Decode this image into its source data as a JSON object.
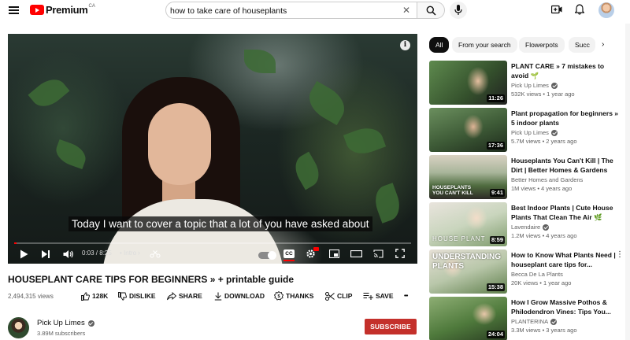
{
  "header": {
    "logo_text": "Premium",
    "region": "CA",
    "search_value": "how to take care of houseplants",
    "clear_symbol": "✕"
  },
  "player": {
    "caption": "Today I want to cover a topic that a lot of you have asked about",
    "time": "0:03 / 8:25",
    "chapter": "• Intro",
    "progress_fraction": 0.006,
    "cc_label": "CC",
    "info_symbol": "i"
  },
  "video": {
    "title": "HOUSEPLANT CARE TIPS FOR BEGINNERS » + printable guide",
    "views": "2,494,315 views",
    "actions": {
      "like": "128K",
      "dislike": "DISLIKE",
      "share": "SHARE",
      "download": "DOWNLOAD",
      "thanks": "THANKS",
      "clip": "CLIP",
      "save": "SAVE",
      "more": "•••"
    },
    "channel_name": "Pick Up Limes",
    "subscribers": "3.89M subscribers",
    "subscribe_label": "SUBSCRIBE"
  },
  "chips": [
    "All",
    "From your search",
    "Flowerpots",
    "Succ"
  ],
  "recommendations": [
    {
      "title": "PLANT CARE » 7 mistakes to avoid 🌱",
      "channel": "Pick Up Limes",
      "verified": true,
      "meta": "532K views • 1 year ago",
      "duration": "11:26",
      "overlay": ""
    },
    {
      "title": "Plant propagation for beginners » 5 indoor plants",
      "channel": "Pick Up Limes",
      "verified": true,
      "meta": "5.7M views • 2 years ago",
      "duration": "17:36",
      "overlay": ""
    },
    {
      "title": "Houseplants You Can't Kill | The Dirt | Better Homes & Gardens",
      "channel": "Better Homes and Gardens",
      "verified": false,
      "meta": "1M views • 4 years ago",
      "duration": "9:41",
      "overlay": "HOUSEPLANTS\nYOU CAN'T KILL"
    },
    {
      "title": "Best Indoor Plants | Cute House Plants That Clean The Air 🌿",
      "channel": "Lavendaire",
      "verified": true,
      "meta": "1.2M views • 4 years ago",
      "duration": "8:59",
      "overlay": "HOUSE PLANT"
    },
    {
      "title": "How to Know What Plants Need | houseplant care tips for...",
      "channel": "Becca De La Plants",
      "verified": false,
      "meta": "20K views • 1 year ago",
      "duration": "15:38",
      "overlay": "UNDERSTANDING\nPLANTS"
    },
    {
      "title": "How I Grow Massive Pothos & Philodendron Vines: Tips You...",
      "channel": "PLANTERINA",
      "verified": true,
      "meta": "3.3M views • 3 years ago",
      "duration": "24:04",
      "overlay": ""
    }
  ]
}
